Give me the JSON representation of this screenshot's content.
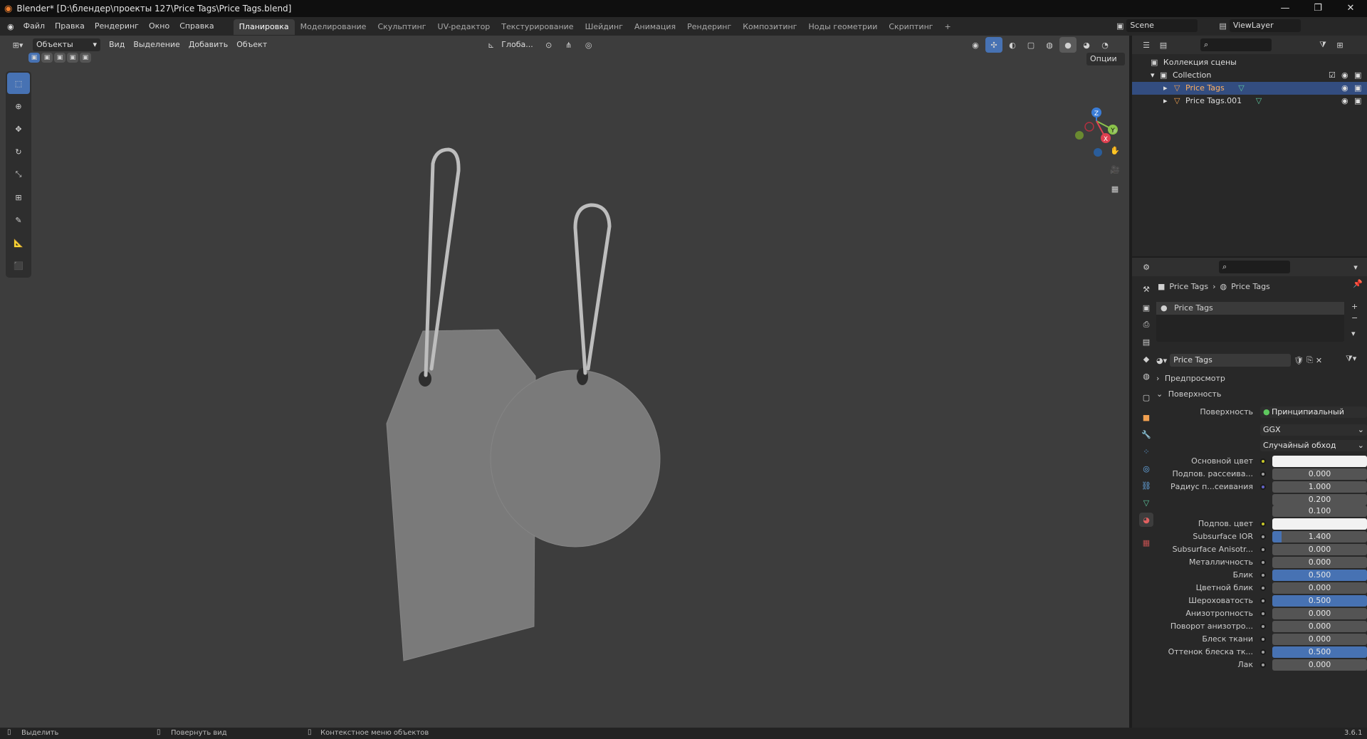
{
  "title": "Blender* [D:\\блендер\\проекты 127\\Price Tags\\Price Tags.blend]",
  "menu": [
    "Файл",
    "Правка",
    "Рендеринг",
    "Окно",
    "Справка"
  ],
  "workspaces": [
    "Планировка",
    "Моделирование",
    "Скульптинг",
    "UV-редактор",
    "Текстурирование",
    "Шейдинг",
    "Анимация",
    "Рендеринг",
    "Композитинг",
    "Ноды геометрии",
    "Скриптинг"
  ],
  "workspace_add": "+",
  "scene": "Scene",
  "view_layer": "ViewLayer",
  "viewport_header": {
    "mode": "Объекты",
    "items": [
      "Вид",
      "Выделение",
      "Добавить",
      "Объект"
    ],
    "transform": "Глоба...",
    "options": "Опции"
  },
  "outliner": {
    "scene_collection": "Коллекция сцены",
    "collection": "Collection",
    "items": [
      "Price Tags",
      "Price Tags.001"
    ]
  },
  "properties": {
    "breadcrumb": [
      "Price Tags",
      "Price Tags"
    ],
    "slot": "Price Tags",
    "material": "Price Tags",
    "panels": {
      "preview": "Предпросмотр",
      "surface": "Поверхность"
    },
    "surface_label": "Поверхность",
    "surface_value": "Принципиальный BSDF",
    "distribution": "GGX",
    "subsurface_method": "Случайный обход",
    "rows": [
      {
        "label": "Основной цвет",
        "value": "",
        "type": "color",
        "dot": "yellow"
      },
      {
        "label": "Подпов. рассеива...",
        "value": "0.000",
        "fill": 0,
        "dot": "gray"
      },
      {
        "label": "Радиус п...сеивания",
        "value": "1.000",
        "fill": 0,
        "dot": "purple"
      },
      {
        "label": "",
        "value": "0.200",
        "fill": 0,
        "dot": "none"
      },
      {
        "label": "",
        "value": "0.100",
        "fill": 0,
        "dot": "none"
      },
      {
        "label": "Подпов. цвет",
        "value": "",
        "type": "color",
        "dot": "yellow"
      },
      {
        "label": "Subsurface IOR",
        "value": "1.400",
        "fill": 0.1,
        "dot": "gray"
      },
      {
        "label": "Subsurface Anisotr...",
        "value": "0.000",
        "fill": 0,
        "dot": "gray"
      },
      {
        "label": "Металличность",
        "value": "0.000",
        "fill": 0,
        "dot": "gray"
      },
      {
        "label": "Блик",
        "value": "0.500",
        "fill": 1,
        "dot": "gray"
      },
      {
        "label": "Цветной блик",
        "value": "0.000",
        "fill": 0,
        "dot": "gray"
      },
      {
        "label": "Шероховатость",
        "value": "0.500",
        "fill": 1,
        "dot": "gray"
      },
      {
        "label": "Анизотропность",
        "value": "0.000",
        "fill": 0,
        "dot": "gray"
      },
      {
        "label": "Поворот анизотро...",
        "value": "0.000",
        "fill": 0,
        "dot": "gray"
      },
      {
        "label": "Блеск ткани",
        "value": "0.000",
        "fill": 0,
        "dot": "gray"
      },
      {
        "label": "Оттенок блеска тк...",
        "value": "0.500",
        "fill": 1,
        "dot": "gray"
      },
      {
        "label": "Лак",
        "value": "0.000",
        "fill": 0,
        "dot": "gray"
      }
    ]
  },
  "status": {
    "select": "Выделить",
    "rotate": "Повернуть вид",
    "context": "Контекстное меню объектов",
    "version": "3.6.1"
  },
  "colors": {
    "accent": "#4772b3",
    "selected_row": "#334d80",
    "viewport": "#3d3d3d"
  }
}
